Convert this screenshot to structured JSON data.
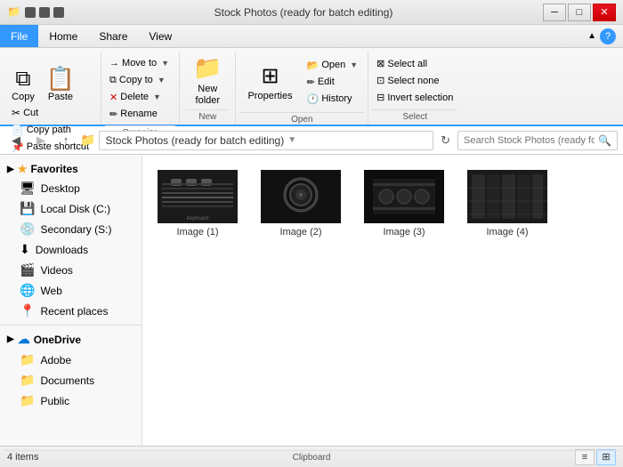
{
  "titleBar": {
    "icon": "📁",
    "title": "Stock Photos (ready for batch editing)",
    "minBtn": "─",
    "maxBtn": "□",
    "closeBtn": "✕"
  },
  "menuBar": {
    "items": [
      {
        "label": "File",
        "active": false
      },
      {
        "label": "Home",
        "active": true
      },
      {
        "label": "Share",
        "active": false
      },
      {
        "label": "View",
        "active": false
      }
    ]
  },
  "ribbon": {
    "groups": [
      {
        "label": "Clipboard",
        "largeButtons": [
          {
            "icon": "📋",
            "label": "Paste"
          }
        ],
        "smallButtons": [
          {
            "icon": "✂",
            "label": "Cut"
          },
          {
            "icon": "📄",
            "label": "Copy path"
          },
          {
            "icon": "📌",
            "label": "Paste shortcut"
          }
        ],
        "copyBtn": {
          "icon": "⧉",
          "label": "Copy"
        }
      }
    ],
    "organizeGroup": {
      "label": "Organize",
      "buttons": [
        {
          "label": "Move to",
          "icon": "→",
          "hasArrow": true
        },
        {
          "label": "Copy to",
          "icon": "⧉",
          "hasArrow": true
        },
        {
          "label": "Delete",
          "icon": "✕",
          "hasArrow": true
        },
        {
          "label": "Rename",
          "icon": "✏"
        }
      ]
    },
    "newGroup": {
      "label": "New",
      "button": {
        "icon": "📁",
        "label": "New\nfolder"
      }
    },
    "openGroup": {
      "label": "Open",
      "buttons": [
        {
          "label": "Open",
          "hasArrow": true
        },
        {
          "label": "Edit"
        },
        {
          "label": "History"
        }
      ]
    },
    "selectGroup": {
      "label": "Select",
      "buttons": [
        {
          "label": "Select all"
        },
        {
          "label": "Select none"
        },
        {
          "label": "Invert selection"
        }
      ]
    },
    "propertiesBtn": {
      "icon": "⊞",
      "label": "Properties"
    }
  },
  "addressBar": {
    "backDisabled": false,
    "forwardDisabled": true,
    "upLabel": "↑",
    "pathParts": [
      {
        "text": "Stock Photos (ready for batch editing)"
      }
    ],
    "searchPlaceholder": "Search Stock Photos (ready fo..."
  },
  "sidebar": {
    "favorites": {
      "header": "Favorites",
      "items": [
        {
          "icon": "🖥",
          "label": "Desktop"
        },
        {
          "icon": "💾",
          "label": "Local Disk (C:)"
        },
        {
          "icon": "💿",
          "label": "Secondary (S:)"
        },
        {
          "icon": "⬇",
          "label": "Downloads"
        },
        {
          "icon": "🎬",
          "label": "Videos"
        },
        {
          "icon": "🌐",
          "label": "Web"
        },
        {
          "icon": "📍",
          "label": "Recent places"
        }
      ]
    },
    "onedrive": {
      "header": "OneDrive",
      "items": [
        {
          "icon": "📁",
          "label": "Adobe"
        },
        {
          "icon": "📁",
          "label": "Documents"
        },
        {
          "icon": "📁",
          "label": "Public"
        }
      ]
    }
  },
  "files": [
    {
      "name": "Image (1)",
      "thumbType": "keyboard"
    },
    {
      "name": "Image (2)",
      "thumbType": "lens"
    },
    {
      "name": "Image (3)",
      "thumbType": "mixer"
    },
    {
      "name": "Image (4)",
      "thumbType": "shelf"
    }
  ],
  "statusBar": {
    "itemCount": "4 items",
    "viewButtons": [
      {
        "label": "≡",
        "active": false
      },
      {
        "label": "⊞",
        "active": true
      }
    ]
  }
}
